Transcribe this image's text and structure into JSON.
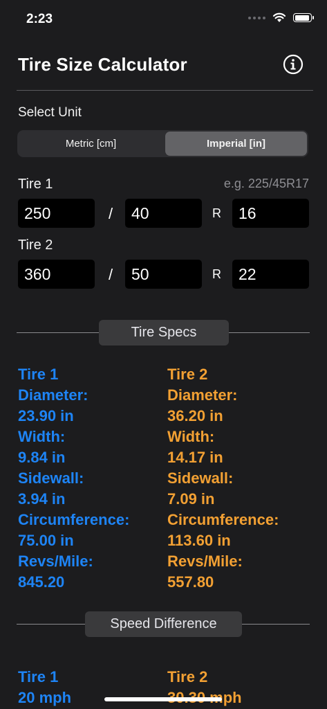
{
  "status_bar": {
    "time": "2:23"
  },
  "header": {
    "title": "Tire Size Calculator"
  },
  "unit": {
    "label": "Select Unit",
    "options": [
      "Metric [cm]",
      "Imperial [in]"
    ],
    "selected": "Imperial [in]"
  },
  "inputs": {
    "example": "e.g. 225/45R17",
    "slash": "/",
    "r": "R",
    "tire1": {
      "label": "Tire 1",
      "width": "250",
      "ratio": "40",
      "rim": "16"
    },
    "tire2": {
      "label": "Tire 2",
      "width": "360",
      "ratio": "50",
      "rim": "22"
    }
  },
  "specs": {
    "section_title": "Tire Specs",
    "tire1": {
      "title": "Tire 1",
      "diameter_label": "Diameter:",
      "diameter": "23.90 in",
      "width_label": "Width:",
      "width": "9.84 in",
      "sidewall_label": "Sidewall:",
      "sidewall": "3.94 in",
      "circumference_label": "Circumference:",
      "circumference": "75.00 in",
      "revs_label": "Revs/Mile:",
      "revs": "845.20"
    },
    "tire2": {
      "title": "Tire 2",
      "diameter_label": "Diameter:",
      "diameter": "36.20 in",
      "width_label": "Width:",
      "width": "14.17 in",
      "sidewall_label": "Sidewall:",
      "sidewall": "7.09 in",
      "circumference_label": "Circumference:",
      "circumference": "113.60 in",
      "revs_label": "Revs/Mile:",
      "revs": "557.80"
    }
  },
  "speed": {
    "section_title": "Speed Difference",
    "tire1": {
      "title": "Tire 1",
      "value": "20 mph"
    },
    "tire2": {
      "title": "Tire 2",
      "value": "30.30 mph"
    }
  },
  "colors": {
    "tire1": "#1e84f5",
    "tire2": "#f2a033",
    "background": "#1c1c1e"
  }
}
